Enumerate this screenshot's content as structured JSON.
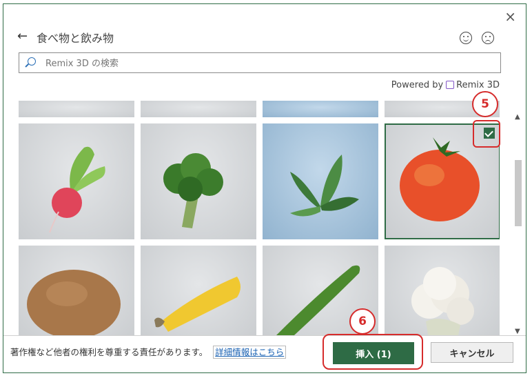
{
  "dialog": {
    "title": "食べ物と飲み物",
    "close_glyph": "×",
    "back_glyph": "←"
  },
  "search": {
    "placeholder": "Remix 3D の検索"
  },
  "powered_by": {
    "prefix": "Powered by",
    "brand": "Remix 3D"
  },
  "tiles": [
    {
      "name": "radish",
      "selected": false
    },
    {
      "name": "broccoli",
      "selected": false
    },
    {
      "name": "leafy-greens",
      "selected": false
    },
    {
      "name": "tomato",
      "selected": true
    },
    {
      "name": "potato",
      "selected": false
    },
    {
      "name": "corn",
      "selected": false
    },
    {
      "name": "cucumber",
      "selected": false
    },
    {
      "name": "cauliflower",
      "selected": false
    }
  ],
  "footer": {
    "notice": "著作権など他者の権利を尊重する責任があります。",
    "link": "詳細情報はこちら",
    "insert_label": "挿入 (1)",
    "cancel_label": "キャンセル"
  },
  "annotations": {
    "step5": "5",
    "step6": "6"
  },
  "colors": {
    "accent": "#2e6b45",
    "annotation": "#d62b2b",
    "link": "#1a62b3"
  }
}
